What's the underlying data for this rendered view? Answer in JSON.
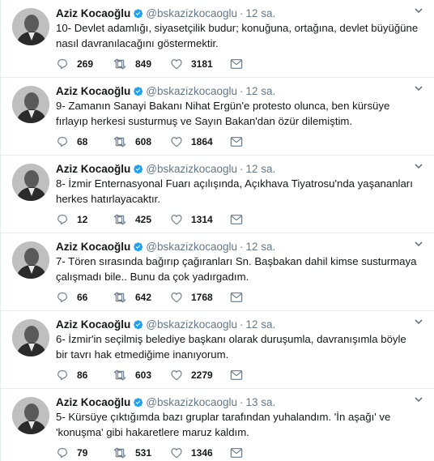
{
  "tweets": [
    {
      "author": "Aziz Kocaoğlu",
      "handle": "@bskazizkocaoglu",
      "time": "12 sa.",
      "text": "10- Devlet adamlığı, siyasetçilik budur; konuğuna, ortağına, devlet büyüğüne nasıl davranılacağını göstermektir.",
      "replies": "269",
      "retweets": "849",
      "likes": "3181"
    },
    {
      "author": "Aziz Kocaoğlu",
      "handle": "@bskazizkocaoglu",
      "time": "12 sa.",
      "text": "9- Zamanın Sanayi Bakanı Nihat Ergün'e protesto olunca, ben kürsüye fırlayıp herkesi susturmuş ve Sayın Bakan'dan özür dilemiştim.",
      "replies": "68",
      "retweets": "608",
      "likes": "1864"
    },
    {
      "author": "Aziz Kocaoğlu",
      "handle": "@bskazizkocaoglu",
      "time": "12 sa.",
      "text": "8- İzmir Enternasyonal Fuarı açılışında, Açıkhava Tiyatrosu'nda yaşananları herkes hatırlayacaktır.",
      "replies": "12",
      "retweets": "425",
      "likes": "1314"
    },
    {
      "author": "Aziz Kocaoğlu",
      "handle": "@bskazizkocaoglu",
      "time": "12 sa.",
      "text": "7- Tören sırasında bağırıp çağıranları Sn. Başbakan dahil kimse susturmaya çalışmadı bile.. Bunu da çok yadırgadım.",
      "replies": "66",
      "retweets": "642",
      "likes": "1768"
    },
    {
      "author": "Aziz Kocaoğlu",
      "handle": "@bskazizkocaoglu",
      "time": "12 sa.",
      "text": "6- İzmir'in seçilmiş belediye başkanı olarak duruşumla, davranışımla böyle bir tavrı hak etmediğime inanıyorum.",
      "replies": "86",
      "retweets": "603",
      "likes": "2279"
    },
    {
      "author": "Aziz Kocaoğlu",
      "handle": "@bskazizkocaoglu",
      "time": "13 sa.",
      "text": "5- Kürsüye çıktığımda bazı gruplar tarafından yuhalandım. 'İn aşağı' ve 'konuşma' gibi hakaretlere maruz kaldım.",
      "replies": "79",
      "retweets": "531",
      "likes": "1346"
    }
  ],
  "colors": {
    "verified": "#1da1f2",
    "icon": "#657786",
    "divider": "#e6ecf0"
  },
  "icons": [
    "verified-badge-icon",
    "chevron-down-icon",
    "reply-icon",
    "retweet-icon",
    "like-icon",
    "message-icon"
  ]
}
